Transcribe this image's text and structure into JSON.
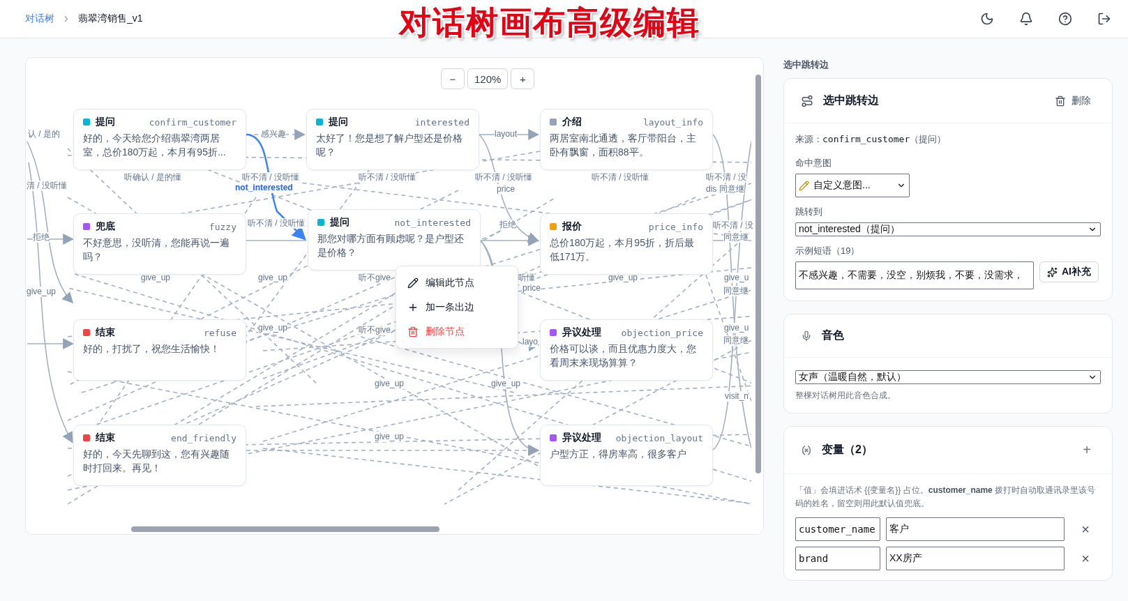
{
  "breadcrumb": [
    {
      "label": "对话树",
      "kind": "link"
    },
    {
      "label": "翡翠湾销售_v1",
      "kind": "current"
    }
  ],
  "banner": "对话树画布高级编辑",
  "canvas": {
    "zoom_out": "−",
    "zoom_value": "120%",
    "zoom_in": "+",
    "nodes": [
      {
        "type": "提问",
        "id": "confirm_customer",
        "text": "好的，今天给您介绍翡翠湾两居室，总价180万起，本月有95折...",
        "color": "#06b6d4"
      },
      {
        "type": "提问",
        "id": "interested",
        "text": "太好了！您是想了解户型还是价格呢？",
        "color": "#06b6d4"
      },
      {
        "type": "介绍",
        "id": "layout_info",
        "text": "两居室南北通透，客厅带阳台，主卧有飘窗，面积88平。",
        "color": "#94a3b8"
      },
      {
        "type": "兜底",
        "id": "fuzzy",
        "text": "不好意思，没听清，您能再说一遍吗？",
        "color": "#a855f7"
      },
      {
        "type": "提问",
        "id": "not_interested",
        "text": "那您对哪方面有顾虑呢？是户型还是价格？",
        "color": "#06b6d4"
      },
      {
        "type": "报价",
        "id": "price_info",
        "text": "总价180万起，本月95折，折后最低171万。",
        "color": "#f59e0b"
      },
      {
        "type": "结束",
        "id": "refuse",
        "text": "好的，打扰了，祝您生活愉快！",
        "color": "#ef4444"
      },
      {
        "type": "异议处理",
        "id": "objection_price",
        "text": "价格可以谈，而且优惠力度大，您看周末来现场算算？",
        "color": "#a855f7"
      },
      {
        "type": "结束",
        "id": "end_friendly",
        "text": "好的，今天先聊到这，您有兴趣随时打回来。再见！",
        "color": "#ef4444"
      },
      {
        "type": "异议处理",
        "id": "objection_layout",
        "text": "户型方正，得房率高，很多客户",
        "color": "#a855f7"
      }
    ],
    "edge_labels": [
      {
        "text": "认 / 是的",
        "selected": false
      },
      {
        "text": "清 / 没听懂",
        "selected": false
      },
      {
        "text": "拒绝",
        "selected": false
      },
      {
        "text": "give_up",
        "selected": false
      },
      {
        "text": "感兴趣",
        "selected": false
      },
      {
        "text": "听确认 / 是的懂",
        "selected": false
      },
      {
        "text": "听不清 / 没听懂",
        "selected": false
      },
      {
        "text": "not_interested",
        "selected": true
      },
      {
        "text": "听不清 / 没听懂",
        "selected": false
      },
      {
        "text": "layout",
        "selected": false
      },
      {
        "text": "听不清 / 没听懂",
        "selected": false
      },
      {
        "text": "price",
        "selected": false
      },
      {
        "text": "听不清 / 没听懂",
        "selected": false
      },
      {
        "text": "听不清 / 没",
        "selected": false
      },
      {
        "text": "dis 同意继",
        "selected": false
      },
      {
        "text": "听不清 / 没听懂",
        "selected": false
      },
      {
        "text": "拒绝",
        "selected": false
      },
      {
        "text": "听不清 / 没",
        "selected": false
      },
      {
        "text": "同意继",
        "selected": false
      },
      {
        "text": "give_up",
        "selected": false
      },
      {
        "text": "give_up",
        "selected": false
      },
      {
        "text": "听不give",
        "selected": false
      },
      {
        "text": "听懂",
        "selected": false
      },
      {
        "text": "price",
        "selected": false
      },
      {
        "text": "give_up",
        "selected": false
      },
      {
        "text": "give_u",
        "selected": false
      },
      {
        "text": "同意继",
        "selected": false
      },
      {
        "text": "give_up",
        "selected": false
      },
      {
        "text": "听不give",
        "selected": false
      },
      {
        "text": "layo",
        "selected": false
      },
      {
        "text": "give_u",
        "selected": false
      },
      {
        "text": "同意继",
        "selected": false
      },
      {
        "text": "give_up",
        "selected": false
      },
      {
        "text": "give_up",
        "selected": false
      },
      {
        "text": "visit_n",
        "selected": false
      },
      {
        "text": "give_up",
        "selected": false
      }
    ],
    "context_menu": [
      {
        "label": "编辑此节点",
        "kind": "edit"
      },
      {
        "label": "加一条出边",
        "kind": "add"
      },
      {
        "label": "删除节点",
        "kind": "delete"
      }
    ]
  },
  "side_panel": {
    "section_label": "选中跳转边",
    "edge_card": {
      "title": "选中跳转边",
      "delete": "删除",
      "source_label": "来源：",
      "source_value": "confirm_customer",
      "source_type": "（提问）",
      "intent_label": "命中意图",
      "intent_value": "自定义意图...",
      "target_label": "跳转到",
      "target_value": "not_interested（提问）",
      "phrases_label": "示例短语（19）",
      "phrases_value": "不感兴趣，不需要，没空，别烦我，不要，没需求，",
      "ai_button": "AI补充"
    },
    "voice_card": {
      "title": "音色",
      "value": "女声（温暖自然，默认）",
      "hint": "整棵对话树用此音色合成。"
    },
    "variables_card": {
      "title": "变量（2）",
      "add": "+",
      "note": "「值」会填进话术 {{变量名}} 占位。**customer_name** 拨打时自动取通讯录里该号码的姓名，留空则用此默认值兜底。",
      "rows": [
        {
          "name": "customer_name",
          "value": "客户",
          "remove": "×"
        },
        {
          "name": "brand",
          "value": "XX房产",
          "remove": "×"
        }
      ]
    }
  }
}
